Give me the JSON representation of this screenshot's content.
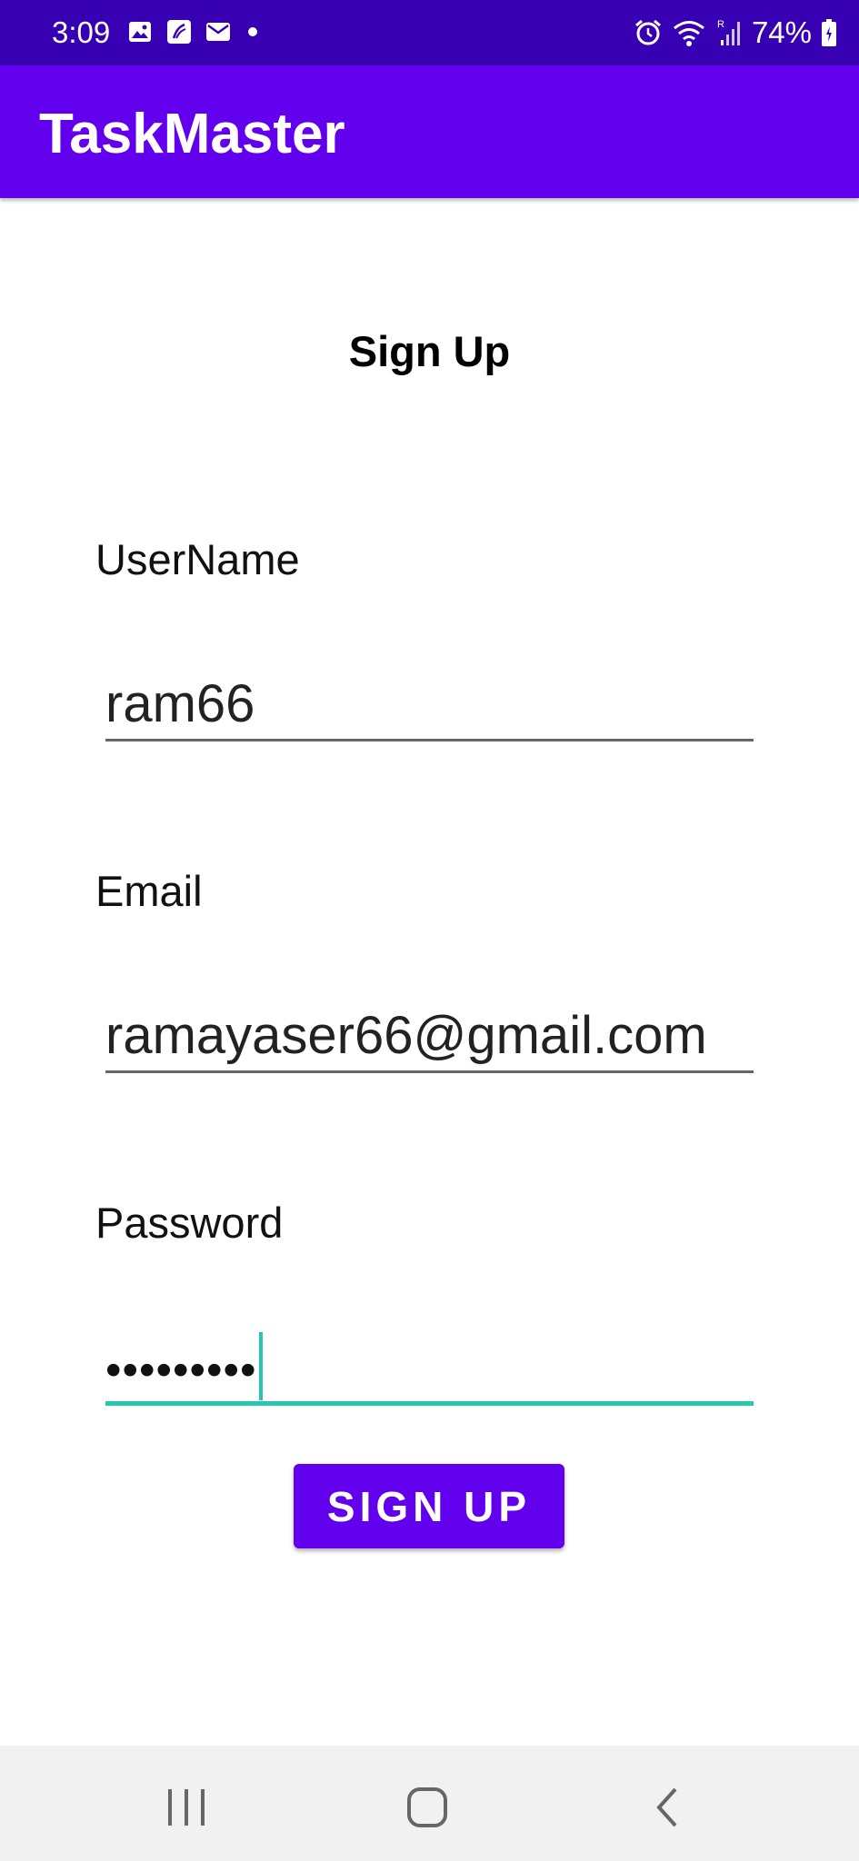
{
  "status_bar": {
    "time": "3:09",
    "battery_percent": "74%",
    "left_icons": [
      "image-icon",
      "app-notification-icon",
      "mail-icon",
      "dot-icon"
    ],
    "right_icons": [
      "alarm-icon",
      "wifi-icon",
      "signal-icon",
      "battery-icon"
    ]
  },
  "app_bar": {
    "title": "TaskMaster"
  },
  "form": {
    "heading": "Sign Up",
    "username_label": "UserName",
    "username_value": "ram66",
    "email_label": "Email",
    "email_value": "ramayaser66@gmail.com",
    "password_label": "Password",
    "password_value": "•••••••••",
    "submit_label": "SIGN UP"
  },
  "nav_bar": {
    "buttons": [
      "recents-icon",
      "home-icon",
      "back-icon"
    ]
  },
  "colors": {
    "status_bar": "#3700b3",
    "primary": "#6200ee",
    "focus_accent": "#26c6b0",
    "nav_bar": "#f1f1f1"
  }
}
